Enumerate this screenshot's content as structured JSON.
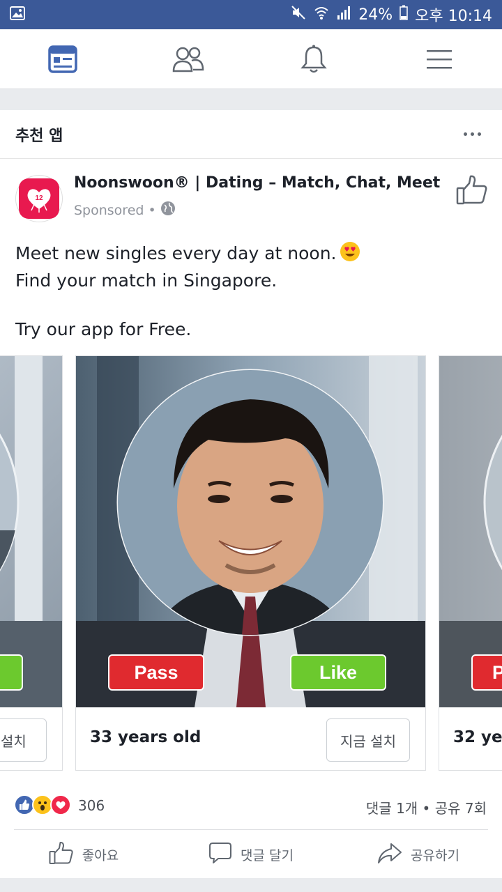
{
  "status_bar": {
    "battery": "24%",
    "time": "오후 10:14"
  },
  "nav": {
    "items": [
      "news-feed",
      "friends",
      "notifications",
      "menu"
    ]
  },
  "section": {
    "title": "추천 앱"
  },
  "post": {
    "app_name": "Noonswoon® |  Dating – Match, Chat, Meet",
    "sponsored": "Sponsored",
    "dot": "•",
    "icon_number": "12",
    "lines": [
      "Meet new singles every day at noon.",
      "Find your match in Singapore.",
      "",
      "Try our app for Free."
    ]
  },
  "carousel": {
    "cards": [
      {
        "caption": "",
        "install": "금 설치"
      },
      {
        "caption": "33 years old",
        "install": "지금 설치",
        "pass": "Pass",
        "like": "Like"
      },
      {
        "caption": "32 yea",
        "pass": "P"
      }
    ]
  },
  "reactions": {
    "count": "306",
    "comments_shares": "댓글 1개 • 공유 7회"
  },
  "actions": {
    "like": "좋아요",
    "comment": "댓글 달기",
    "share": "공유하기"
  },
  "colors": {
    "brand": "#3b5998",
    "accent": "#4267b2",
    "pass": "#e02a2f",
    "like": "#6cc92e",
    "app_icon": "#e8194f"
  }
}
